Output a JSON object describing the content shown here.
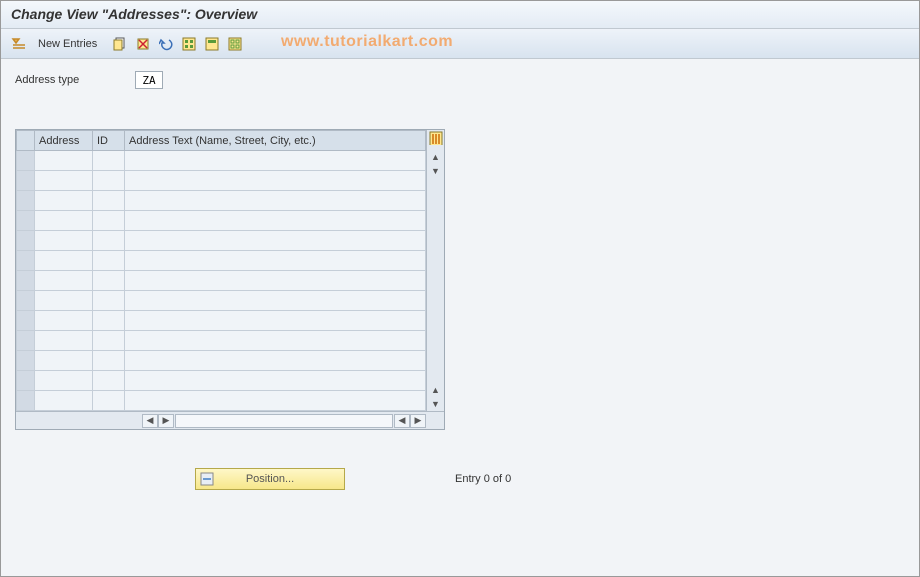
{
  "title": "Change View \"Addresses\": Overview",
  "toolbar": {
    "new_entries_label": "New Entries"
  },
  "watermark": "www.tutorialkart.com",
  "form": {
    "address_type_label": "Address type",
    "address_type_value": "ZA"
  },
  "table": {
    "columns": {
      "address": "Address",
      "id": "ID",
      "address_text": "Address Text (Name, Street, City, etc.)"
    },
    "row_count": 13
  },
  "footer": {
    "position_label": "Position...",
    "entry_text": "Entry 0 of 0"
  }
}
